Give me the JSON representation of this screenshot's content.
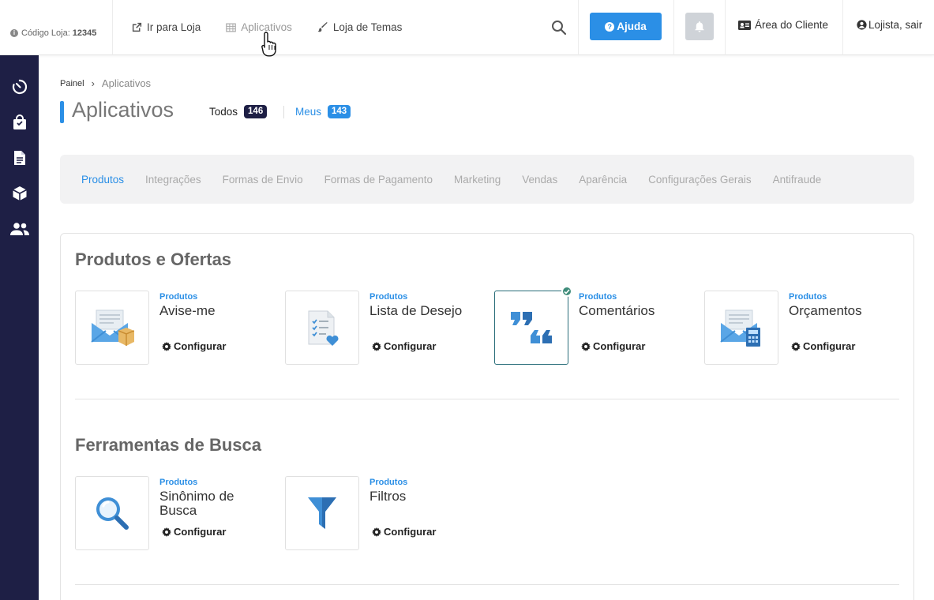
{
  "topbar": {
    "store_code_label": "Código Loja:",
    "store_code_value": "12345",
    "nav": [
      {
        "label": "Ir para Loja",
        "icon": "external-link-icon"
      },
      {
        "label": "Aplicativos",
        "icon": "grid-icon"
      },
      {
        "label": "Loja de Temas",
        "icon": "brush-icon"
      }
    ],
    "help_label": "Ajuda",
    "client_area_label": "Área do Cliente",
    "logout_label": "Lojista, sair"
  },
  "sidebar": {
    "items": [
      {
        "icon": "timer-icon"
      },
      {
        "icon": "shopping-bag-icon"
      },
      {
        "icon": "document-icon"
      },
      {
        "icon": "box-icon"
      },
      {
        "icon": "users-icon"
      }
    ]
  },
  "breadcrumb": {
    "home": "Painel",
    "current": "Aplicativos"
  },
  "page": {
    "title": "Aplicativos",
    "filter_all_label": "Todos",
    "filter_all_count": "146",
    "filter_mine_label": "Meus",
    "filter_mine_count": "143"
  },
  "category_tabs": [
    "Produtos",
    "Integrações",
    "Formas de Envio",
    "Formas de Pagamento",
    "Marketing",
    "Vendas",
    "Aparência",
    "Configurações Gerais",
    "Antifraude"
  ],
  "active_tab": "Produtos",
  "sections": [
    {
      "title": "Produtos e Ofertas",
      "apps": [
        {
          "category": "Produtos",
          "name": "Avise-me",
          "action": "Configurar",
          "icon": "envelope-box-icon",
          "installed": false
        },
        {
          "category": "Produtos",
          "name": "Lista de Desejo",
          "action": "Configurar",
          "icon": "checklist-heart-icon",
          "installed": false
        },
        {
          "category": "Produtos",
          "name": "Comentários",
          "action": "Configurar",
          "icon": "quotes-icon",
          "installed": true
        },
        {
          "category": "Produtos",
          "name": "Orçamentos",
          "action": "Configurar",
          "icon": "envelope-calculator-icon",
          "installed": false
        }
      ]
    },
    {
      "title": "Ferramentas de Busca",
      "apps": [
        {
          "category": "Produtos",
          "name": "Sinônimo de Busca",
          "action": "Configurar",
          "icon": "magnifier-icon",
          "installed": false
        },
        {
          "category": "Produtos",
          "name": "Filtros",
          "action": "Configurar",
          "icon": "funnel-icon",
          "installed": false
        }
      ]
    }
  ],
  "colors": {
    "accent": "#2b8fe6",
    "sidebar": "#1e1f45",
    "installed_check": "#3f8c7a"
  }
}
